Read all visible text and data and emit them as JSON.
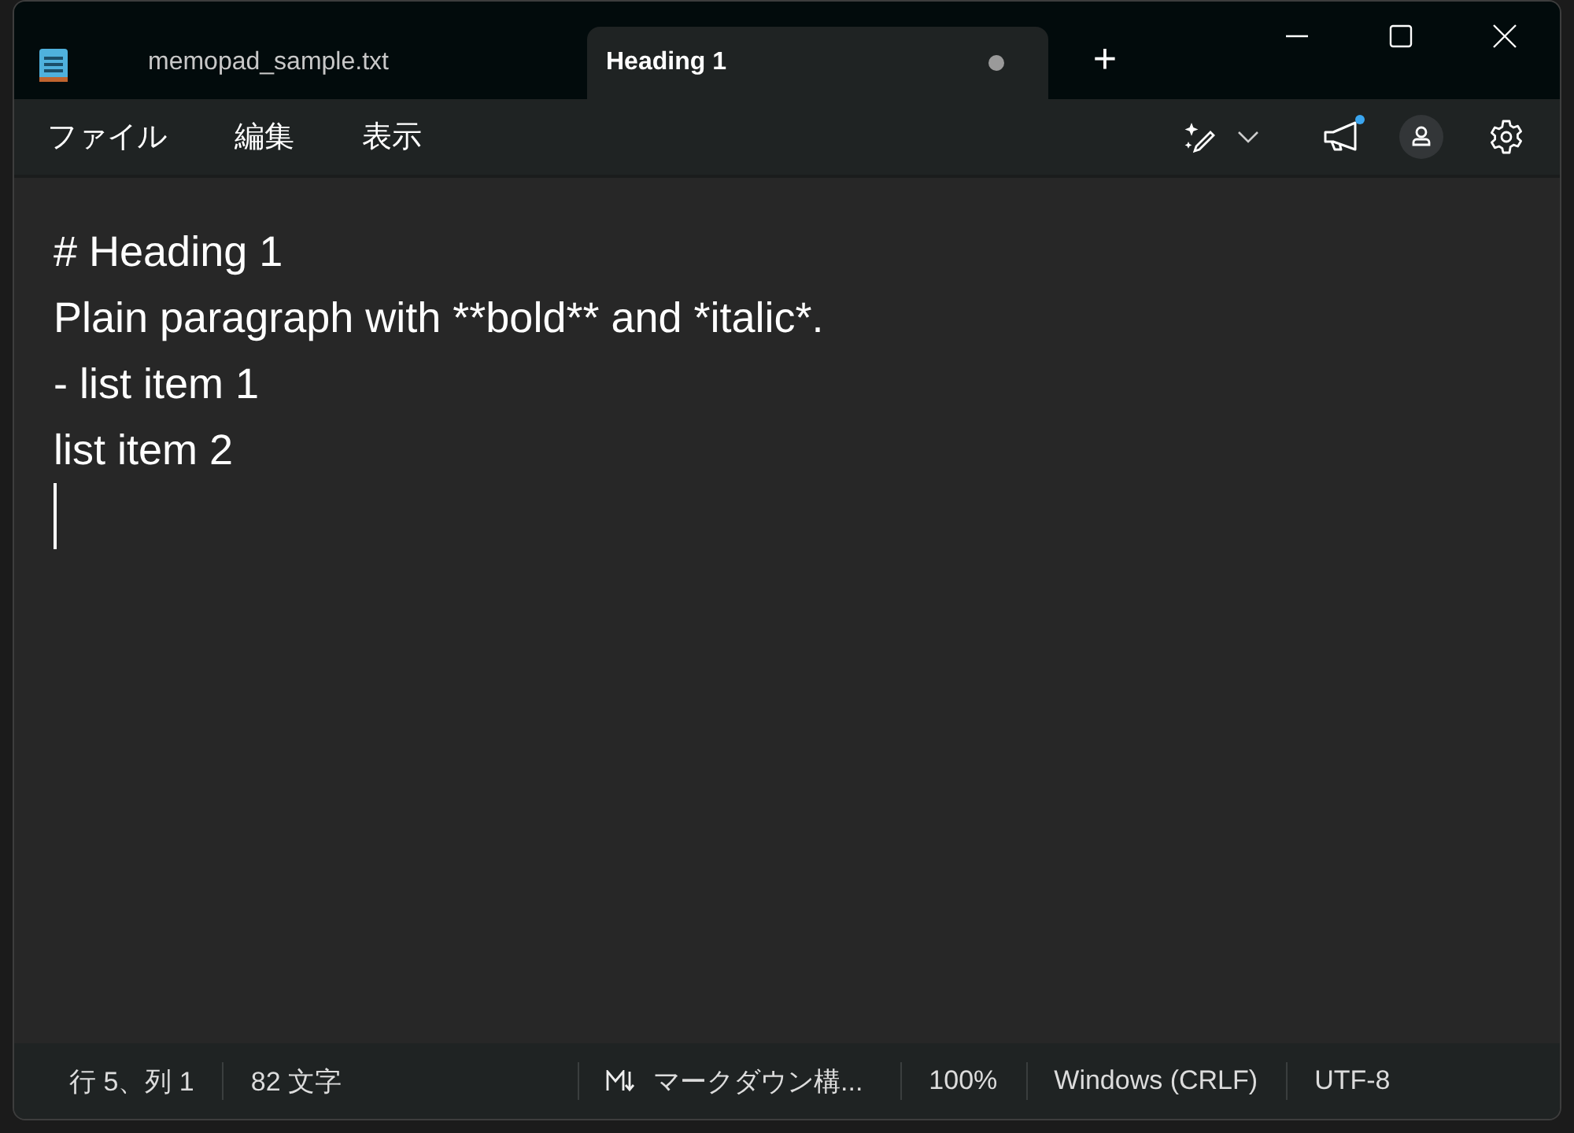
{
  "tabs": [
    {
      "label": "memopad_sample.txt",
      "selected": false,
      "modified": false
    },
    {
      "label": "Heading 1",
      "selected": true,
      "modified": true
    }
  ],
  "new_tab": "+",
  "menu": [
    "ファイル",
    "編集",
    "表示"
  ],
  "toolbar": {
    "notification": true
  },
  "editor": {
    "lines": [
      "# Heading 1",
      "Plain paragraph with **bold** and *italic*.",
      "- list item 1",
      "list item 2"
    ],
    "cursor_on_new_line": true
  },
  "status_bar": [
    {
      "kind": "text",
      "text": "行 5、列 1"
    },
    {
      "kind": "text",
      "text": "82 文字"
    },
    {
      "kind": "markdown",
      "text": "マークダウン構..."
    },
    {
      "kind": "text",
      "text": "100%"
    },
    {
      "kind": "text",
      "text": "Windows (CRLF)"
    },
    {
      "kind": "text",
      "text": "UTF-8"
    }
  ]
}
